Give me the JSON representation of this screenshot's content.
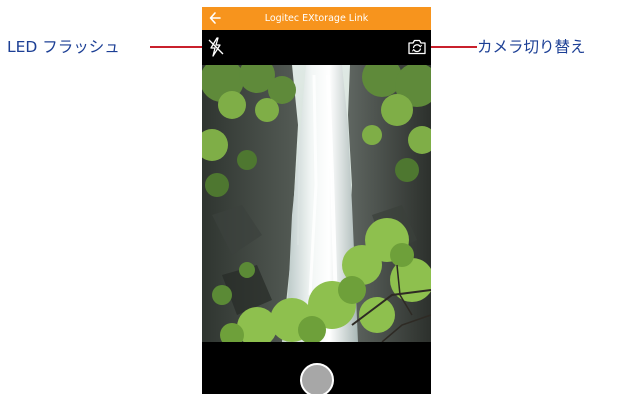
{
  "app": {
    "title": "Logitec EXtorage Link",
    "accent_color": "#f7941d"
  },
  "toolbar": {
    "flash_icon": "flash-off-icon",
    "switch_icon": "camera-switch-icon"
  },
  "shutter": {
    "icon": "shutter-button-icon"
  },
  "callouts": {
    "left_label": "LED フラッシュ",
    "right_label": "カメラ切り替え",
    "line_color": "#c9202c",
    "text_color": "#1c3f95"
  }
}
